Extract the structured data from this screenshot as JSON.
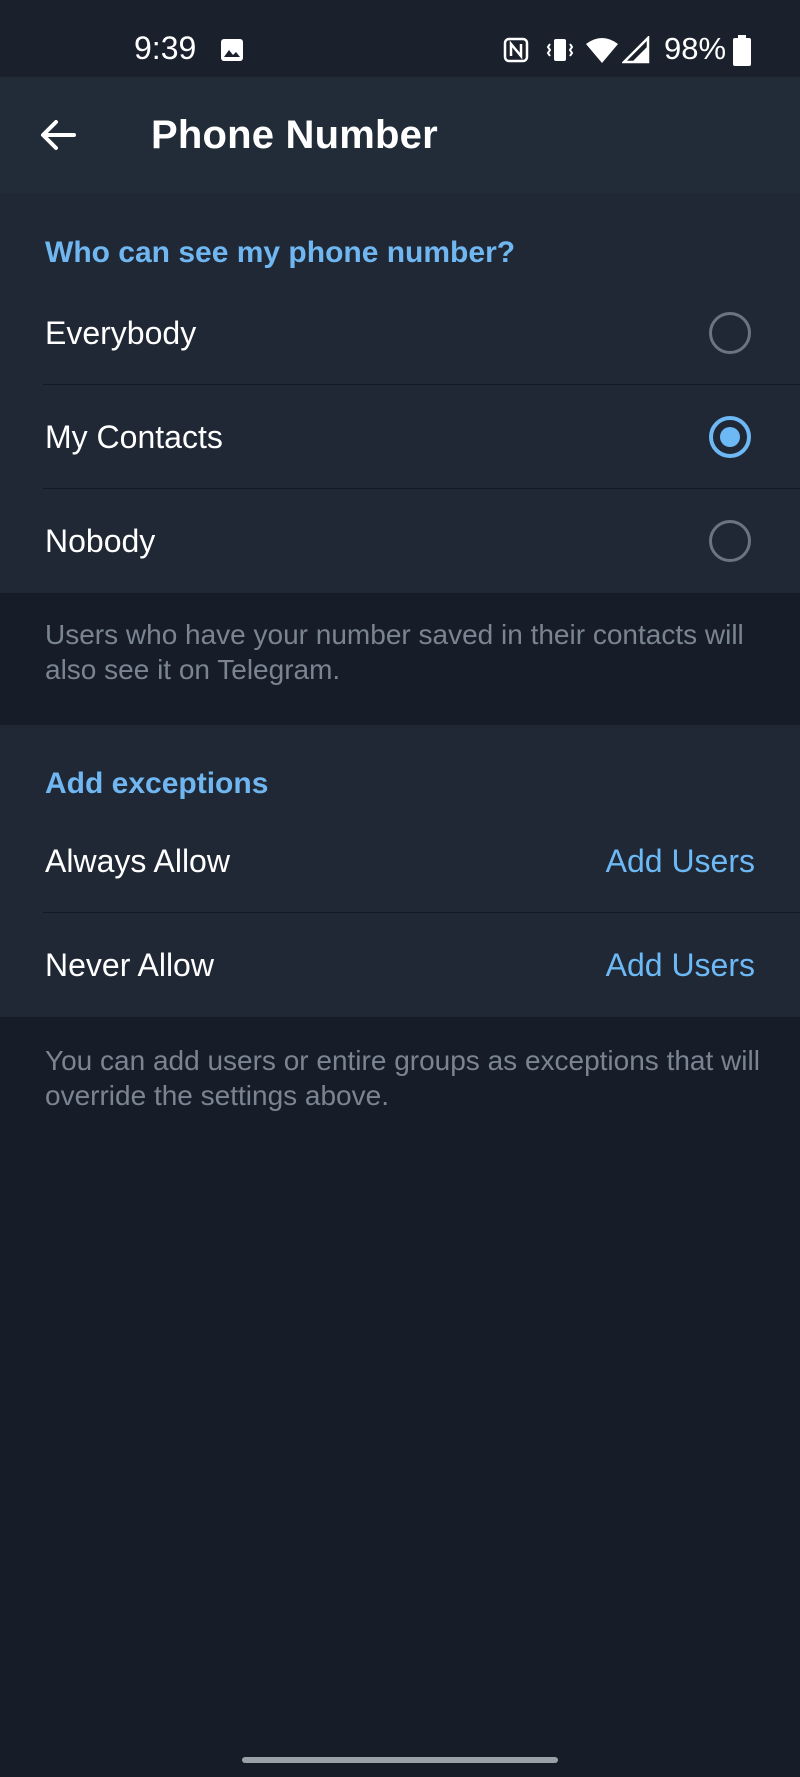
{
  "status_bar": {
    "time": "9:39",
    "battery_percent": "98%",
    "battery_level": 0.98,
    "icons": [
      "gallery-icon",
      "nfc-icon",
      "vibrate-icon",
      "wifi-icon",
      "cell-signal-icon",
      "battery-icon"
    ]
  },
  "appbar": {
    "back_icon": "arrow-left-icon",
    "title": "Phone Number"
  },
  "visibility": {
    "header": "Who can see my phone number?",
    "options": [
      {
        "label": "Everybody",
        "checked": false
      },
      {
        "label": "My Contacts",
        "checked": true
      },
      {
        "label": "Nobody",
        "checked": false
      }
    ],
    "info": "Users who have your number saved in their contacts will also see it on Telegram."
  },
  "exceptions": {
    "header": "Add exceptions",
    "rows": [
      {
        "label": "Always Allow",
        "action": "Add Users"
      },
      {
        "label": "Never Allow",
        "action": "Add Users"
      }
    ],
    "info": "You can add users or entire groups as exceptions that will override the settings above."
  },
  "colors": {
    "accent": "#6db9f5",
    "header_text": "#70b7f2",
    "background": "#171d28",
    "section_bg": "#202835",
    "appbar_bg": "#222b38"
  }
}
